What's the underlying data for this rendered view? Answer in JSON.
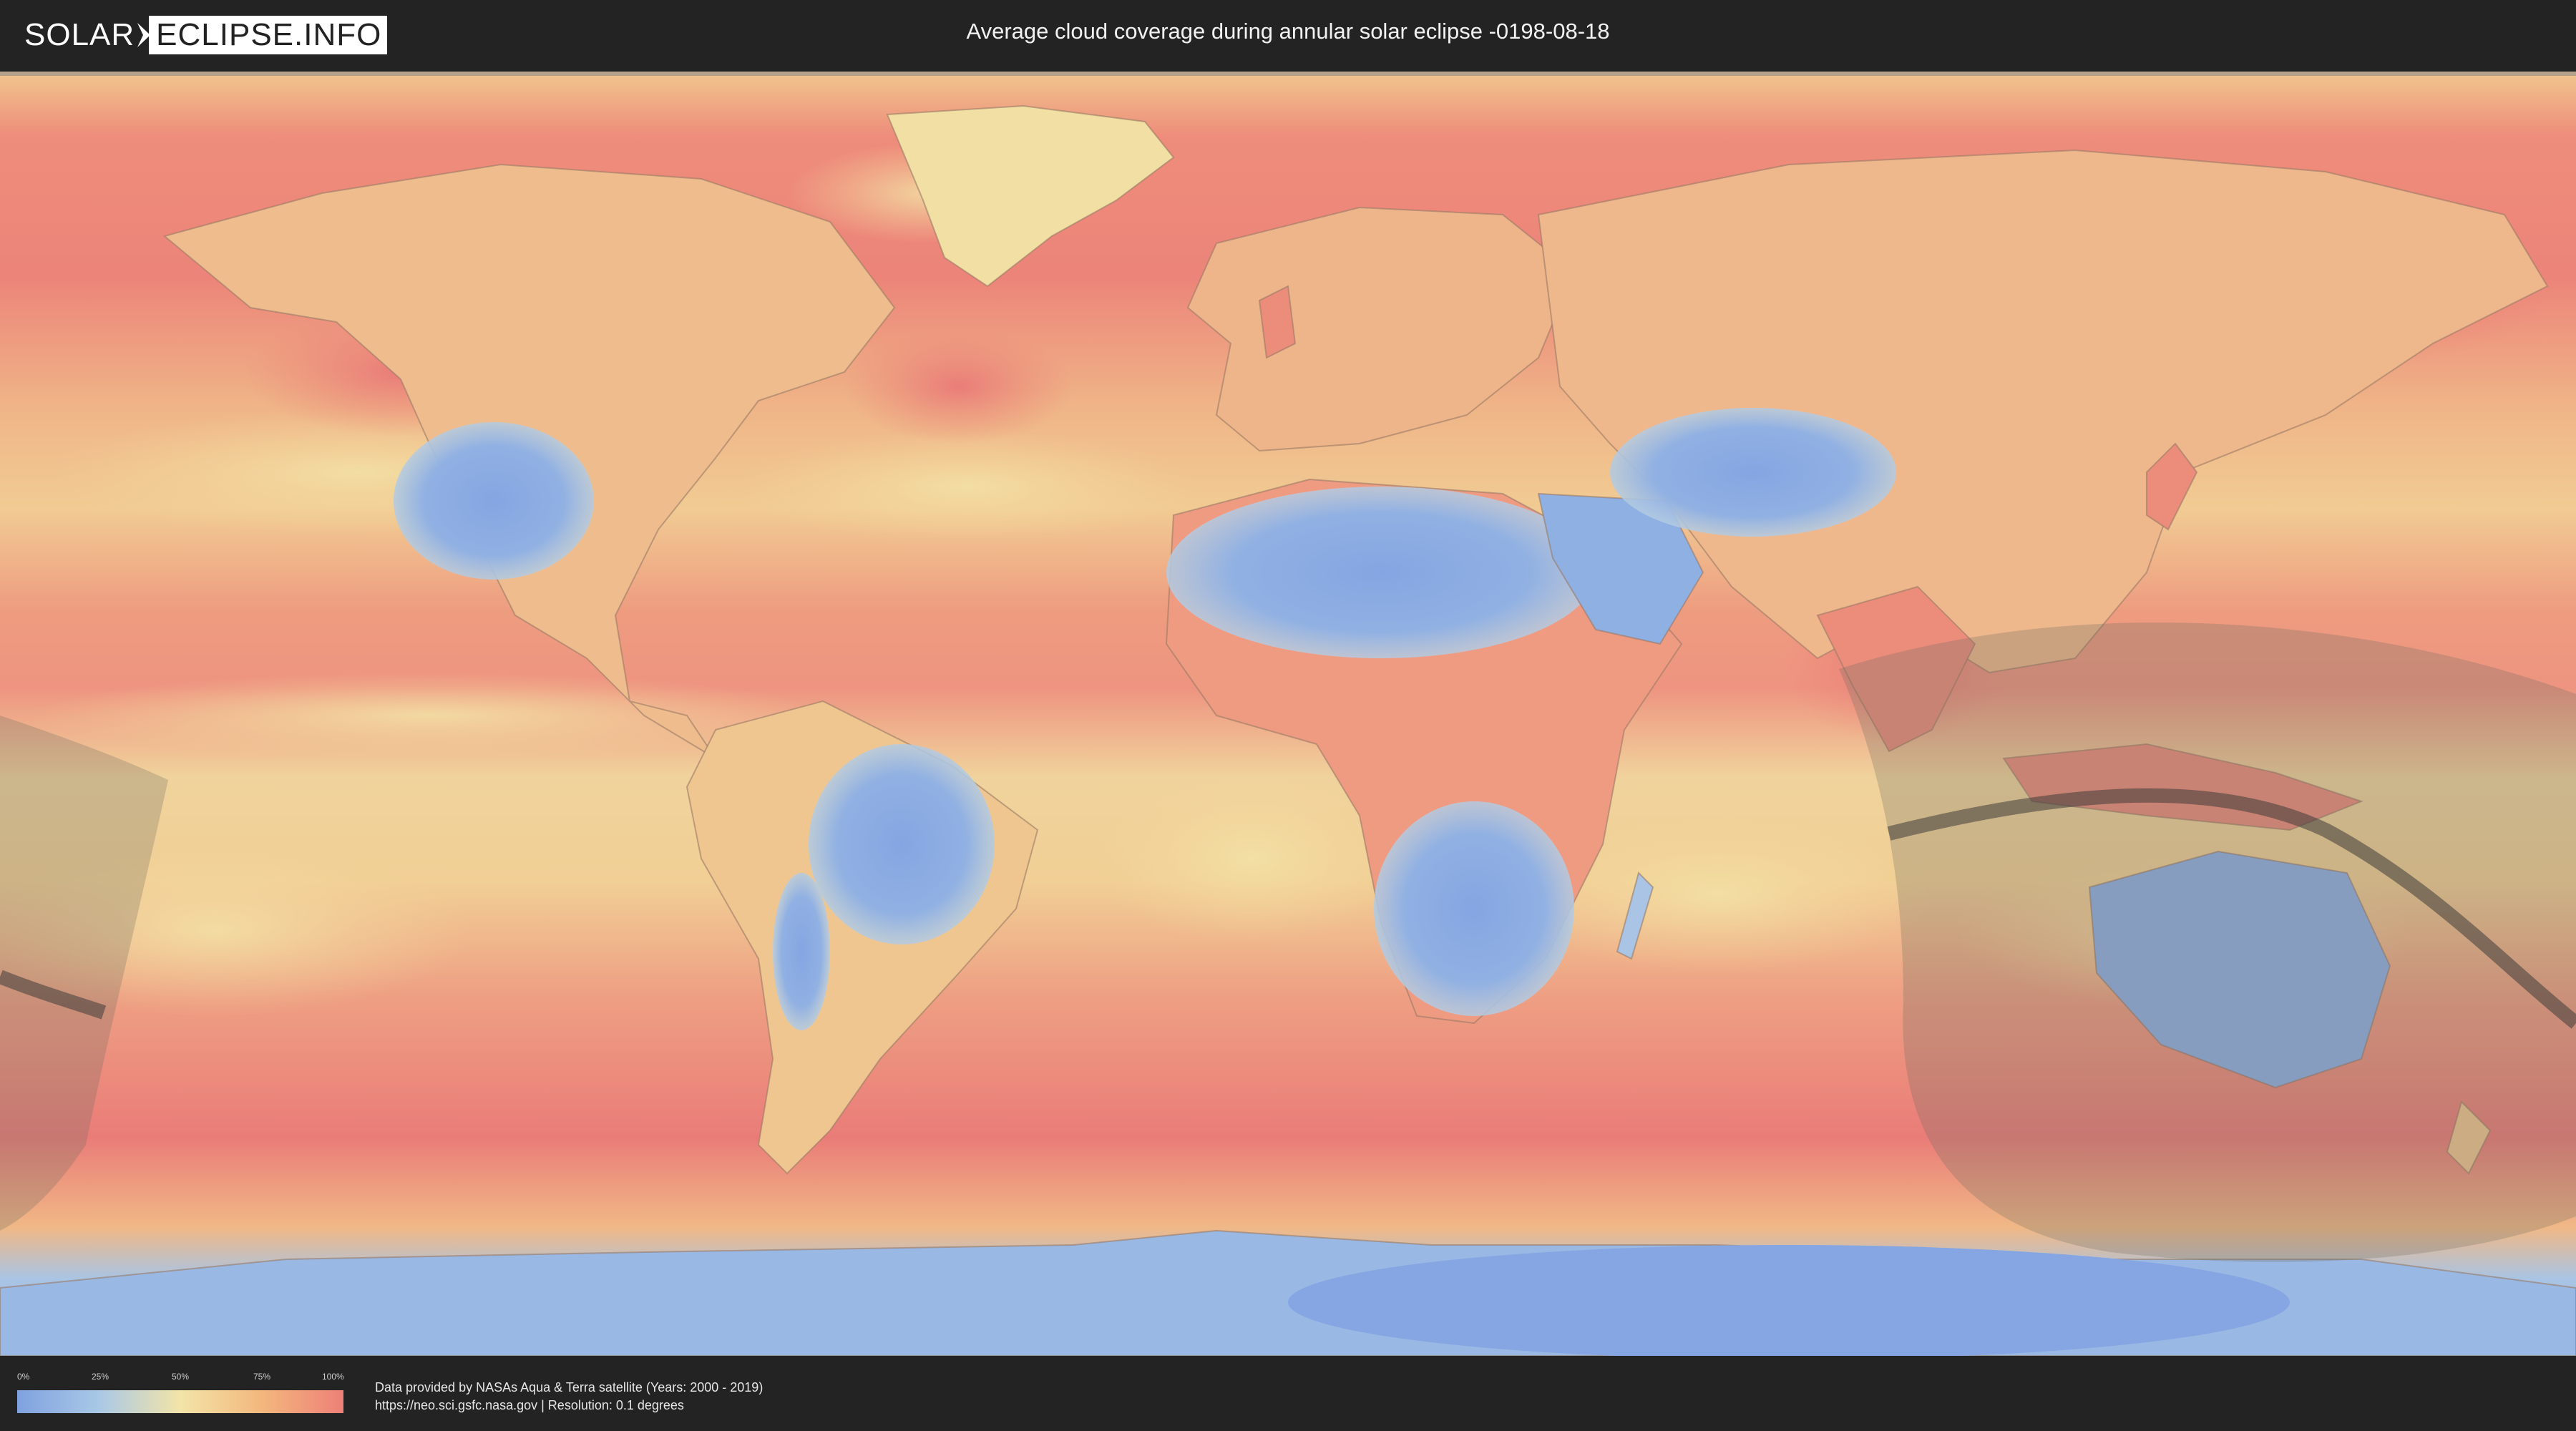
{
  "header": {
    "logo_left": "SOLAR",
    "logo_right": "ECLIPSE.INFO",
    "title": "Average cloud coverage during annular solar eclipse -0198-08-18"
  },
  "legend": {
    "ticks": [
      "0%",
      "25%",
      "50%",
      "75%",
      "100%"
    ],
    "colors": [
      "#7fa2e0",
      "#a9c8e6",
      "#f3e4a8",
      "#f3b77d",
      "#ee8078"
    ]
  },
  "footer": {
    "source_line1": "Data provided by NASAs Aqua & Terra satellite (Years: 2000 - 2019)",
    "source_line2": "https://neo.sci.gsfc.nasa.gov | Resolution: 0.1 degrees"
  },
  "map": {
    "projection": "equirectangular world map",
    "colors": {
      "clear_sky": "#7fa2e0",
      "light_cloud": "#a9c8e6",
      "medium_cloud": "#f3d89a",
      "heavy_cloud": "#ee8078",
      "eclipse_shadow": "#6f6b62",
      "central_line": "#3f3d3a",
      "country_borders": "#8a6f5a"
    }
  }
}
